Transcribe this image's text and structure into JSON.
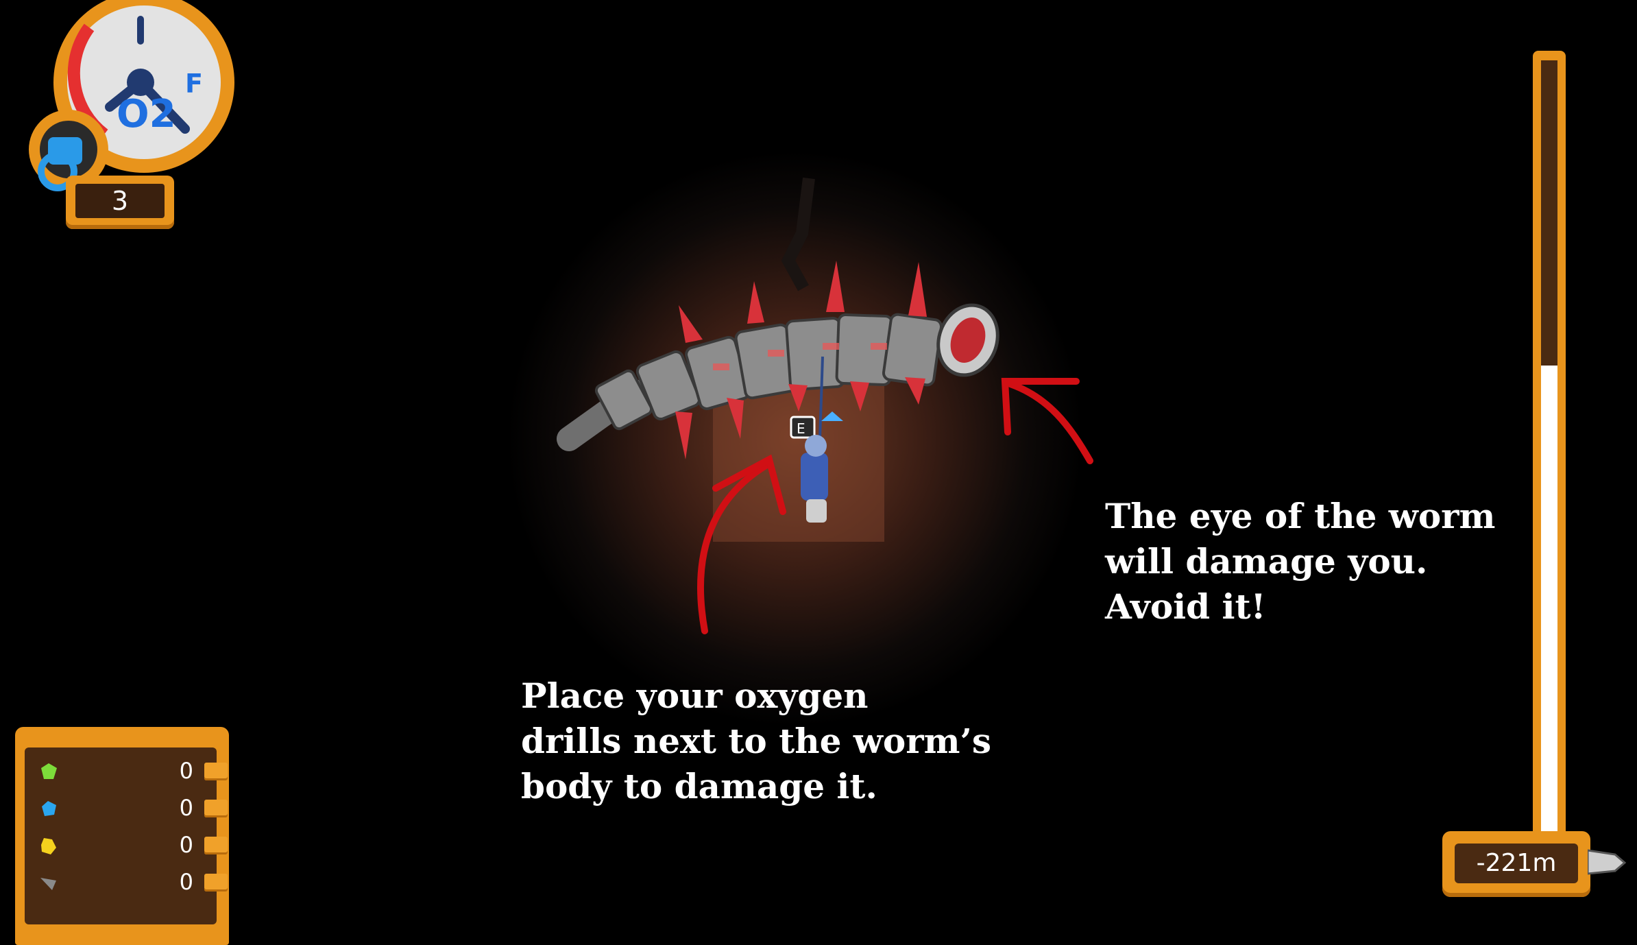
{
  "hud": {
    "oxygen_gauge": {
      "label": "O2",
      "full_marker": "F",
      "level_fraction": 0.1
    },
    "oxygen_tanks": {
      "count": "3"
    },
    "inventory": [
      {
        "icon": "green-gem-icon",
        "count": "0",
        "color": "#7ddc3a"
      },
      {
        "icon": "blue-gem-icon",
        "count": "0",
        "color": "#2aa6f0"
      },
      {
        "icon": "gold-nugget-icon",
        "count": "0",
        "color": "#f5d21e"
      },
      {
        "icon": "stone-ore-icon",
        "count": "0",
        "color": "#8a8a8a"
      }
    ],
    "depth": {
      "value": "-221m",
      "progress_fraction": 0.6
    }
  },
  "annotations": {
    "eye": [
      "The eye of the worm",
      "will damage you.",
      "Avoid it!"
    ],
    "drill": [
      "Place your oxygen",
      "drills next to the worm’s",
      "body to damage it."
    ]
  },
  "colors": {
    "hud_frame": "#e8941c",
    "hud_dark": "#4a2a12",
    "arrow": "#d10f14",
    "worm_spike": "#d8323a"
  }
}
